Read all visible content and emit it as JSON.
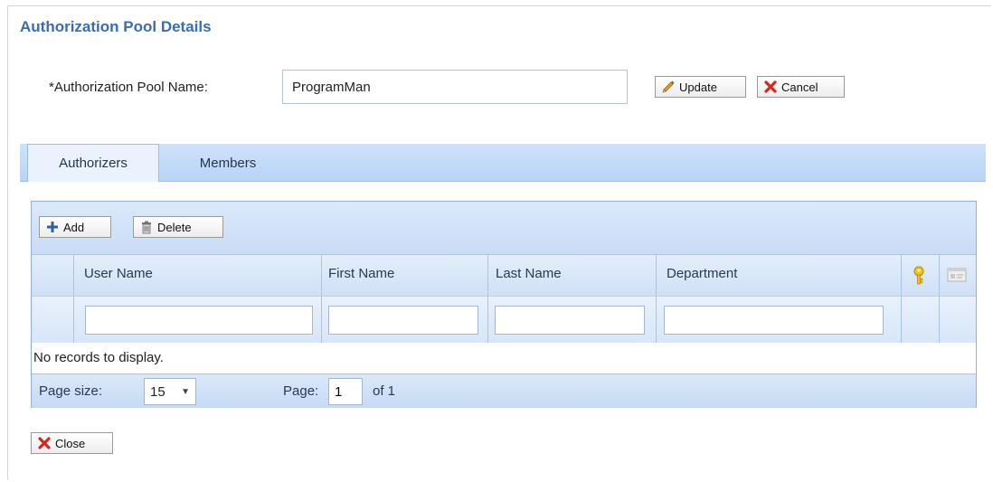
{
  "page": {
    "title": "Authorization Pool Details"
  },
  "form": {
    "name_label": "*Authorization Pool Name:",
    "name_value": "ProgramMan",
    "update_label": "Update",
    "cancel_label": "Cancel",
    "close_label": "Close"
  },
  "tabs": [
    {
      "label": "Authorizers",
      "active": true
    },
    {
      "label": "Members",
      "active": false
    }
  ],
  "grid": {
    "add_label": "Add",
    "delete_label": "Delete",
    "columns": [
      "User Name",
      "First Name",
      "Last Name",
      "Department"
    ],
    "icon_columns": [
      "key-icon",
      "card-icon"
    ],
    "empty_message": "No records to display.",
    "pager": {
      "page_size_label": "Page size:",
      "page_size_value": "15",
      "page_label": "Page:",
      "page_value": "1",
      "of_label": "of 1"
    }
  },
  "colors": {
    "title": "#3a6cb4",
    "header_blue": "#c9dcf5"
  }
}
